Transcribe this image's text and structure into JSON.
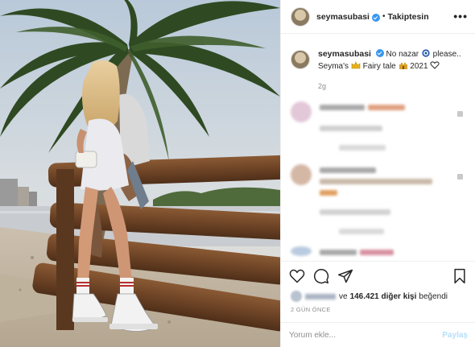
{
  "header": {
    "username": "seymasubasi",
    "separator": "•",
    "follow_status": "Takiptesin",
    "more_label": "•••"
  },
  "caption": {
    "username": "seymasubasi",
    "text_1": "No nazar",
    "text_2": "please..",
    "text_3": "Seyma's",
    "text_4": "Fairy tale",
    "text_5": "2021",
    "time_ago": "2g"
  },
  "likes": {
    "prefix": "ve",
    "count": "146.421 diğer kişi",
    "suffix": "beğendi"
  },
  "post_date": "2 GÜN ÖNCE",
  "comment_box": {
    "placeholder": "Yorum ekle...",
    "post_label": "Paylaş"
  },
  "icons": {
    "like": "heart-icon",
    "comment": "comment-icon",
    "share": "share-icon",
    "save": "bookmark-icon",
    "more": "more-options-icon",
    "verified": "verified-badge-icon",
    "nazar": "nazar-eye-emoji-icon",
    "crown": "crown-emoji-icon",
    "castle": "castle-emoji-icon",
    "heart_caption": "heart-outline-emoji-icon"
  },
  "colors": {
    "verified_blue": "#3897f0",
    "post_button_disabled": "#b2dffc",
    "muted_text": "#8e8e8e"
  }
}
